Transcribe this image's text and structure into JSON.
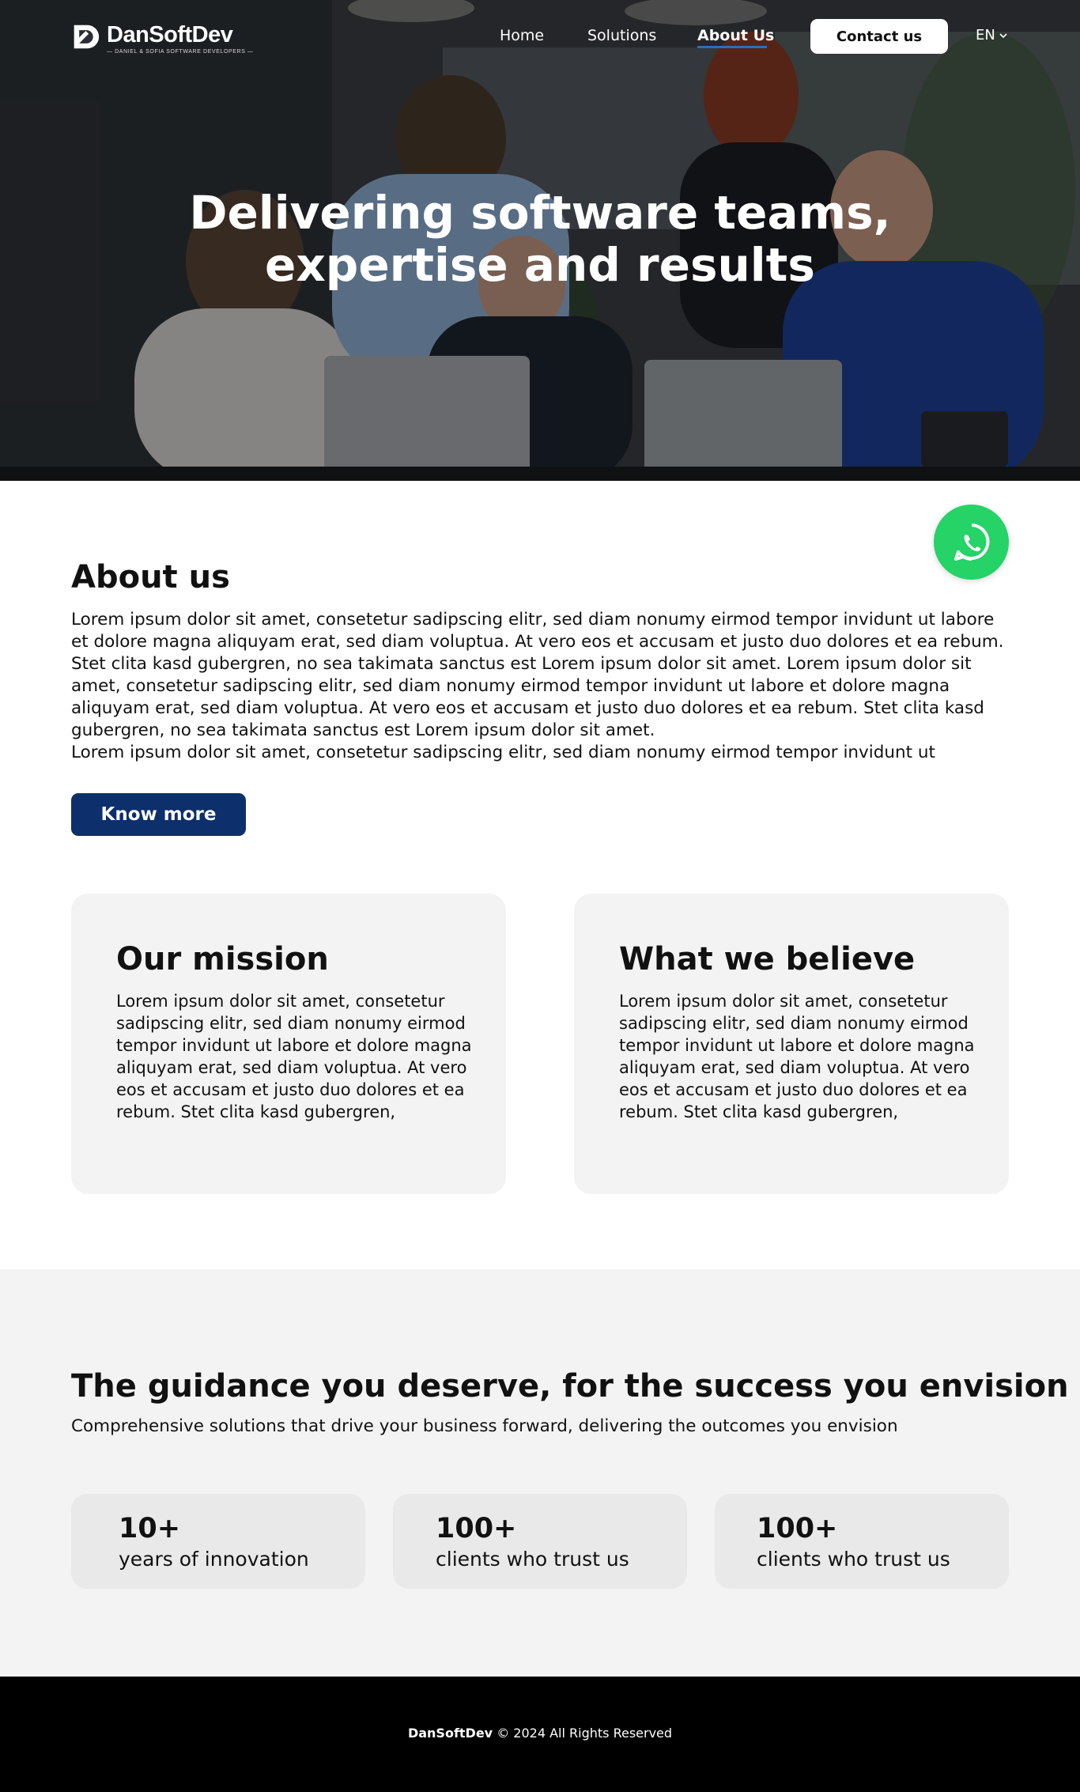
{
  "brand": {
    "name": "DanSoftDev",
    "tagline": "— Daniel & Sofia Software Developers —"
  },
  "nav": {
    "items": [
      {
        "label": "Home"
      },
      {
        "label": "Solutions"
      },
      {
        "label": "About Us",
        "active": true
      }
    ],
    "contact_label": "Contact us",
    "language": "EN"
  },
  "hero": {
    "title_line1": "Delivering software teams,",
    "title_line2": "expertise and results"
  },
  "whatsapp": {
    "icon": "whatsapp-icon",
    "color": "#25d366"
  },
  "about": {
    "heading": "About us",
    "paragraph1": "Lorem ipsum dolor sit amet, consetetur sadipscing elitr, sed diam nonumy eirmod tempor invidunt ut labore et dolore magna aliquyam erat, sed diam voluptua. At vero eos et accusam et justo duo dolores et ea rebum. Stet clita kasd gubergren, no sea takimata sanctus est Lorem ipsum dolor sit amet. Lorem ipsum dolor sit amet, consetetur sadipscing elitr, sed diam nonumy eirmod tempor invidunt ut labore et dolore magna aliquyam erat, sed diam voluptua. At vero eos et accusam et justo duo dolores et ea rebum. Stet clita kasd gubergren, no sea takimata sanctus est Lorem ipsum dolor sit amet.",
    "paragraph2": "Lorem ipsum dolor sit amet, consetetur sadipscing elitr, sed diam nonumy eirmod tempor invidunt ut",
    "button_label": "Know more",
    "button_color": "#0d2f6b"
  },
  "cards": [
    {
      "title": "Our mission",
      "text": "Lorem ipsum dolor sit amet, consetetur sadipscing elitr, sed diam nonumy eirmod tempor invidunt ut labore et dolore magna aliquyam erat, sed diam voluptua. At vero eos et accusam et justo duo dolores et ea rebum. Stet clita kasd gubergren,"
    },
    {
      "title": "What we believe",
      "text": "Lorem ipsum dolor sit amet, consetetur sadipscing elitr, sed diam nonumy eirmod tempor invidunt ut labore et dolore magna aliquyam erat, sed diam voluptua. At vero eos et accusam et justo duo dolores et ea rebum. Stet clita kasd gubergren,"
    }
  ],
  "guidance": {
    "heading": "The guidance you deserve, for the success you envision",
    "subheading": "Comprehensive solutions that drive your business forward, delivering the outcomes you envision",
    "stats": [
      {
        "number": "10+",
        "label": "years of innovation"
      },
      {
        "number": "100+",
        "label": "clients who trust us"
      },
      {
        "number": "100+",
        "label": "clients who trust us"
      }
    ]
  },
  "footer": {
    "brand": "DanSoftDev",
    "copyright": "© 2024 All Rights Reserved"
  }
}
